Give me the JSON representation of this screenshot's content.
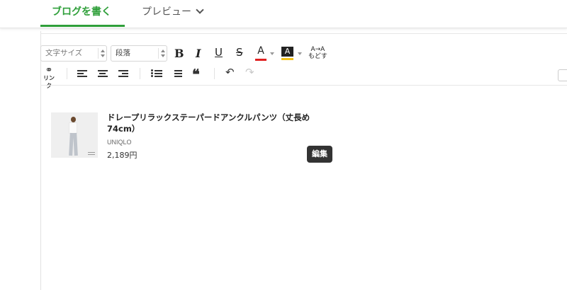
{
  "tabs": {
    "write": "ブログを書く",
    "preview": "プレビュー"
  },
  "toolbar": {
    "font_size_placeholder": "文字サイズ",
    "paragraph_select": "段落",
    "bold": "B",
    "italic": "I",
    "underline": "U",
    "strike": "S",
    "font_color": "A",
    "highlight": "A",
    "reset_label": "もどす",
    "reset_top": "A→A",
    "link_label": "リンク",
    "quote": "❝",
    "undo": "↶",
    "redo": "↷",
    "icons": [
      "link-icon",
      "align-left-icon",
      "align-center-icon",
      "align-right-icon",
      "bullet-list-icon",
      "numbered-list-icon",
      "quote-icon",
      "undo-icon",
      "redo-icon"
    ],
    "colors": {
      "font_color_bar": "#e02020",
      "highlight_bar": "#f2c21b",
      "accent": "#2f9f3a"
    }
  },
  "product": {
    "title": "ドレープリラックステーパードアンクルパンツ（丈長め74cm）",
    "brand": "UNIQLO",
    "price": "2,189円",
    "edit_badge": "編集"
  }
}
